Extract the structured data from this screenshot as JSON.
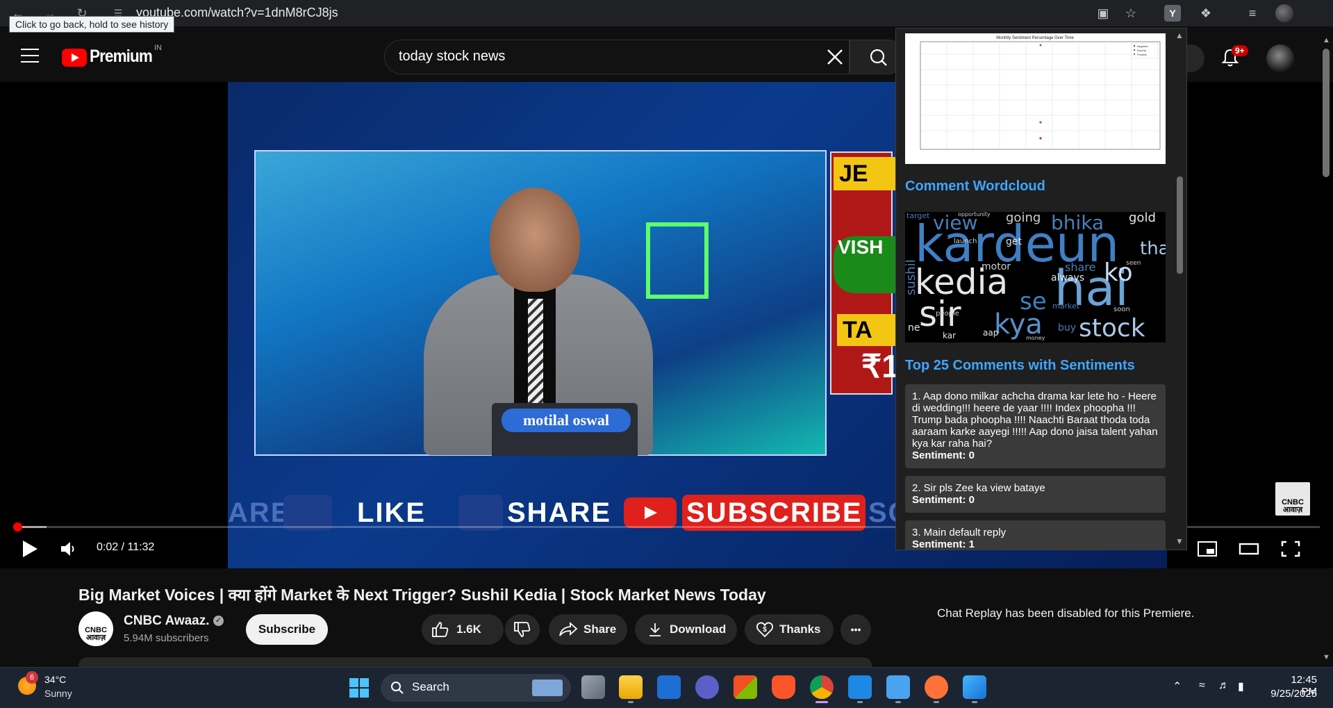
{
  "browser": {
    "url": "youtube.com/watch?v=1dnM8rCJ8js",
    "tooltip": "Click to go back, hold to see history",
    "extension_label": "Y"
  },
  "header": {
    "brand": "Premium",
    "country": "IN",
    "search_value": "today stock news",
    "notification_count": "9+",
    "create_partial": "e"
  },
  "video": {
    "time": "0:02 / 11:32",
    "progress_fraction": 0.0029,
    "buffer_fraction": 0.025,
    "on_screen": {
      "laptop_brand": "motilal oswal",
      "banner_prefix": "ARE",
      "banner_like": "LIKE",
      "banner_share": "SHARE",
      "banner_subscribe": "SUBSCRIBE",
      "banner_suffix": "SC",
      "side_ticker_1": "JE",
      "side_ticker_2": "VISH",
      "side_ticker_3": "TA",
      "side_price": "₹1",
      "watermark": "CNBC आवाज़"
    }
  },
  "extension_panel": {
    "chart": {
      "title": "Monthly Sentiment Percentage Over Time",
      "legend": [
        "Negative",
        "Neutral",
        "Positive"
      ]
    },
    "wordcloud_heading": "Comment Wordcloud",
    "wordcloud_words": {
      "big": [
        "kardeun",
        "hai",
        "kedia",
        "sir",
        "kya",
        "stock",
        "ko",
        "view",
        "bhika",
        "se",
        "tha"
      ],
      "small": [
        "going",
        "gold",
        "get",
        "motor",
        "always",
        "people",
        "buy",
        "aap",
        "kar",
        "launch",
        "share",
        "market",
        "seen",
        "soon",
        "money",
        "opportunity",
        "sushil",
        "ne",
        "target"
      ]
    },
    "comments_heading": "Top 25 Comments with Sentiments",
    "comments": [
      {
        "text": "1. Aap dono milkar achcha drama kar lete ho - Heere di wedding!!! heere de yaar !!!! Index phoopha !!! Trump bada phoopha !!!! Naachti Baraat thoda toda aaraam karke aayegi !!!!! Aap dono jaisa talent yahan kya kar raha hai?",
        "sentiment": "Sentiment: 0"
      },
      {
        "text": "2. Sir pls Zee ka view bataye",
        "sentiment": "Sentiment: 0"
      },
      {
        "text": "3. Main default reply",
        "sentiment": "Sentiment: 1"
      }
    ]
  },
  "below_video": {
    "title": "Big Market Voices | क्या होंगे Market के Next Trigger? Sushil Kedia | Stock Market News Today",
    "channel_name": "CNBC Awaaz.",
    "channel_avatar_text": "CNBC आवाज़",
    "subscribers": "5.94M subscribers",
    "subscribe_label": "Subscribe",
    "like_count": "1.6K",
    "share_label": "Share",
    "download_label": "Download",
    "thanks_label": "Thanks",
    "more_label": "•••",
    "chat_disabled": "Chat Replay has been disabled for this Premiere."
  },
  "taskbar": {
    "weather_badge": "6",
    "temperature": "34°C",
    "condition": "Sunny",
    "search_label": "Search",
    "time": "12:45 PM",
    "date": "9/25/2025"
  },
  "colors": {
    "accent_red": "#ff0000",
    "link_blue": "#3ea6ff",
    "background": "#0f0f0f"
  }
}
